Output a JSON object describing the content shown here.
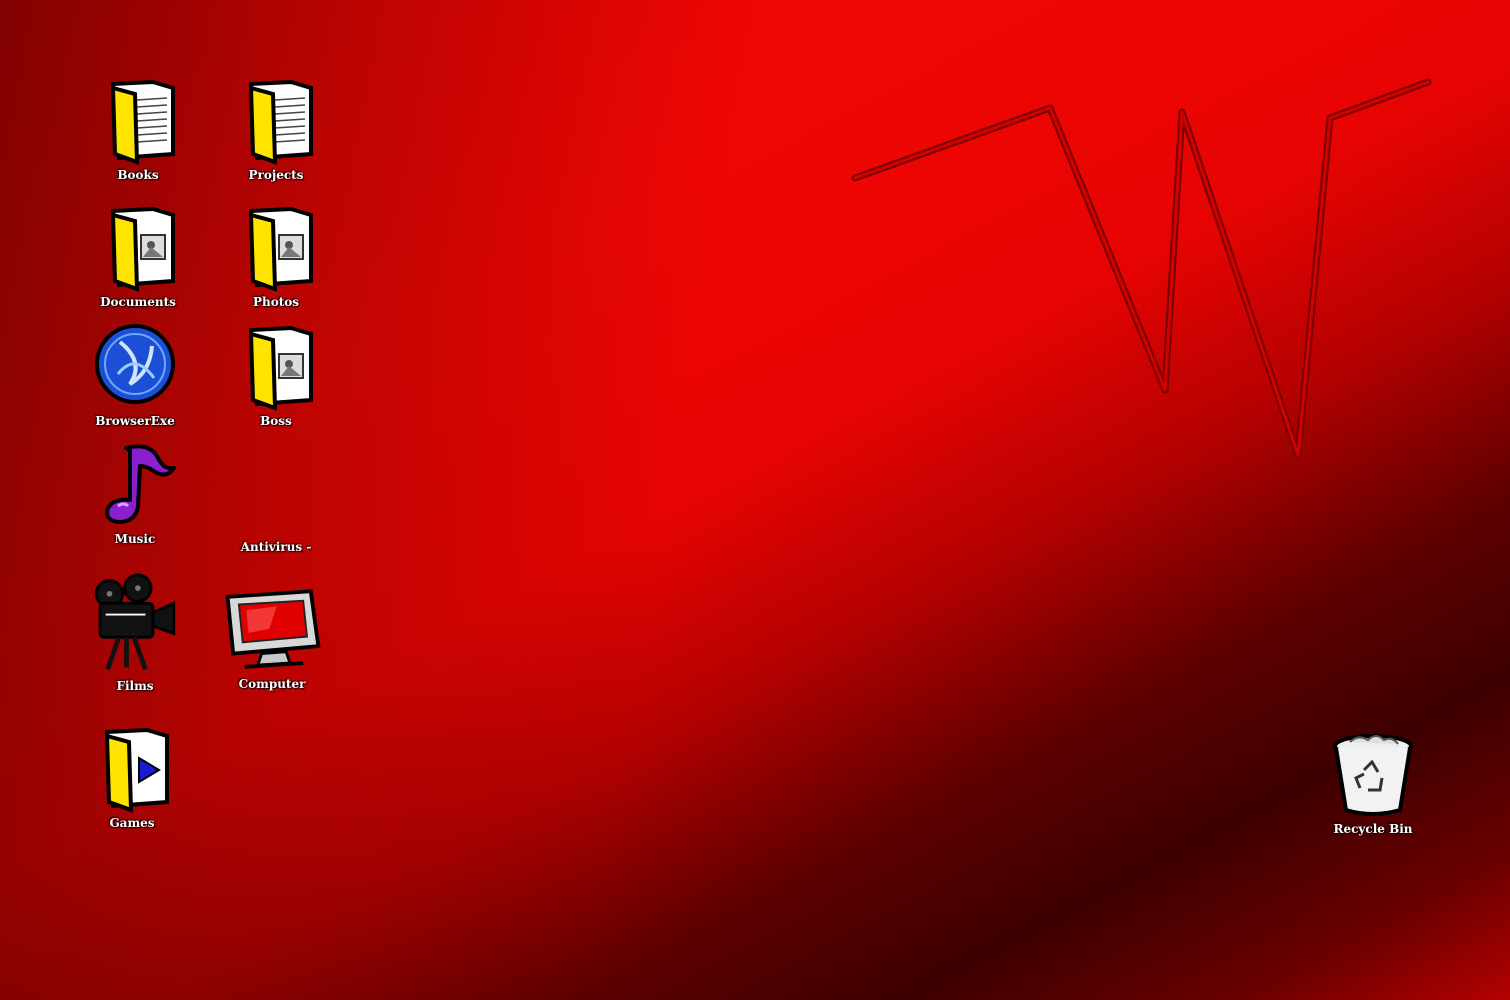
{
  "desktop": {
    "background_colors": [
      "#f00603",
      "#e60402",
      "#5e0000",
      "#3e0000"
    ],
    "logo": {
      "letter": "W",
      "stroke_color": "#a00000",
      "name": "w-logo"
    },
    "icons": [
      {
        "id": "books",
        "label": "Books",
        "icon": "folder-documents-icon"
      },
      {
        "id": "projects",
        "label": "Projects",
        "icon": "folder-documents-icon"
      },
      {
        "id": "documents",
        "label": "Documents",
        "icon": "folder-picture-icon"
      },
      {
        "id": "photos",
        "label": "Photos",
        "icon": "folder-picture-icon"
      },
      {
        "id": "browserexe",
        "label": "BrowserExe",
        "icon": "globe-icon"
      },
      {
        "id": "boss",
        "label": "Boss",
        "icon": "folder-picture-icon"
      },
      {
        "id": "music",
        "label": "Music",
        "icon": "music-note-icon"
      },
      {
        "id": "antivirus",
        "label": "Antivirus -",
        "icon": ""
      },
      {
        "id": "films",
        "label": "Films",
        "icon": "film-camera-icon"
      },
      {
        "id": "computer",
        "label": "Computer",
        "icon": "monitor-icon"
      },
      {
        "id": "games",
        "label": "Games",
        "icon": "folder-play-icon"
      },
      {
        "id": "recycle",
        "label": "Recycle Bin",
        "icon": "recycle-bin-icon"
      }
    ]
  }
}
